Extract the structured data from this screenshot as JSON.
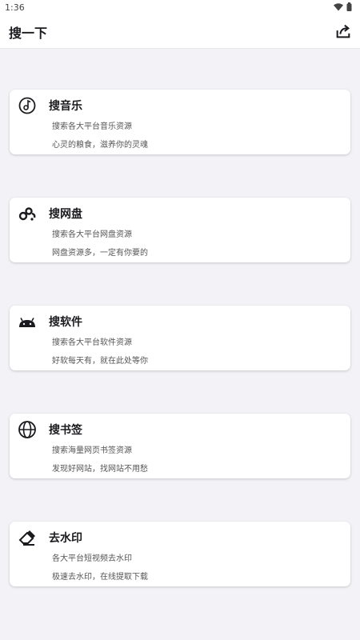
{
  "status": {
    "time": "1:36"
  },
  "appbar": {
    "title": "搜一下",
    "share_icon": "share-icon"
  },
  "cards": [
    {
      "icon": "music-icon",
      "title": "搜音乐",
      "line1": "搜索各大平台音乐资源",
      "line2": "心灵的粮食，滋养你的灵魂"
    },
    {
      "icon": "netdisk-icon",
      "title": "搜网盘",
      "line1": "搜索各大平台网盘资源",
      "line2": "网盘资源多，一定有你要的"
    },
    {
      "icon": "android-icon",
      "title": "搜软件",
      "line1": "搜索各大平台软件资源",
      "line2": "好软每天有，就在此处等你"
    },
    {
      "icon": "globe-icon",
      "title": "搜书签",
      "line1": "搜索海量网页书签资源",
      "line2": "发现好网站，找网站不用愁"
    },
    {
      "icon": "eraser-icon",
      "title": "去水印",
      "line1": "各大平台短视频去水印",
      "line2": "极速去水印，在线提取下载"
    }
  ]
}
